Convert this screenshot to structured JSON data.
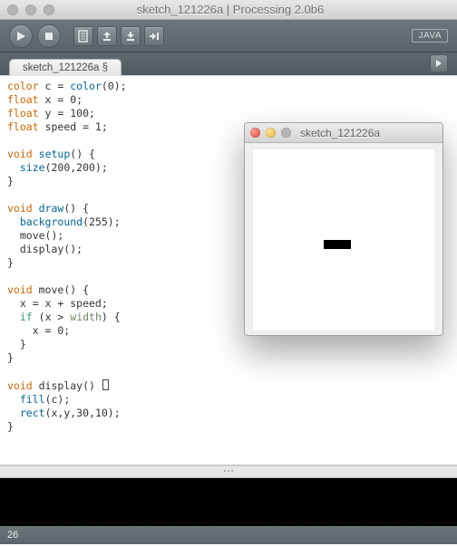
{
  "titlebar": {
    "title": "sketch_121226a | Processing 2.0b6"
  },
  "toolbar": {
    "mode": "JAVA"
  },
  "tabbar": {
    "tab_label": "sketch_121226a §"
  },
  "status": {
    "line": "26"
  },
  "sketch_window": {
    "title": "sketch_121226a"
  },
  "code": {
    "l1a": "color",
    "l1b": " c = ",
    "l1c": "color",
    "l1d": "(0);",
    "l2a": "float",
    "l2b": " x = 0;",
    "l3a": "float",
    "l3b": " y = 100;",
    "l4a": "float",
    "l4b": " speed = 1;",
    "l6a": "void",
    "l6b": " ",
    "l6c": "setup",
    "l6d": "() {",
    "l7a": "  ",
    "l7b": "size",
    "l7c": "(200,200);",
    "l8": "}",
    "l10a": "void",
    "l10b": " ",
    "l10c": "draw",
    "l10d": "() {",
    "l11a": "  ",
    "l11b": "background",
    "l11c": "(255);",
    "l12": "  move();",
    "l13": "  display();",
    "l14": "}",
    "l16a": "void",
    "l16b": " move() {",
    "l17": "  x = x + speed;",
    "l18a": "  ",
    "l18b": "if",
    "l18c": " (x > ",
    "l18d": "width",
    "l18e": ") {",
    "l19": "    x = 0;",
    "l20": "  }",
    "l21": "}",
    "l23a": "void",
    "l23b": " display() ",
    "l24a": "  ",
    "l24b": "fill",
    "l24c": "(c);",
    "l25a": "  ",
    "l25b": "rect",
    "l25c": "(x,y,30,10);",
    "l26": "}"
  }
}
